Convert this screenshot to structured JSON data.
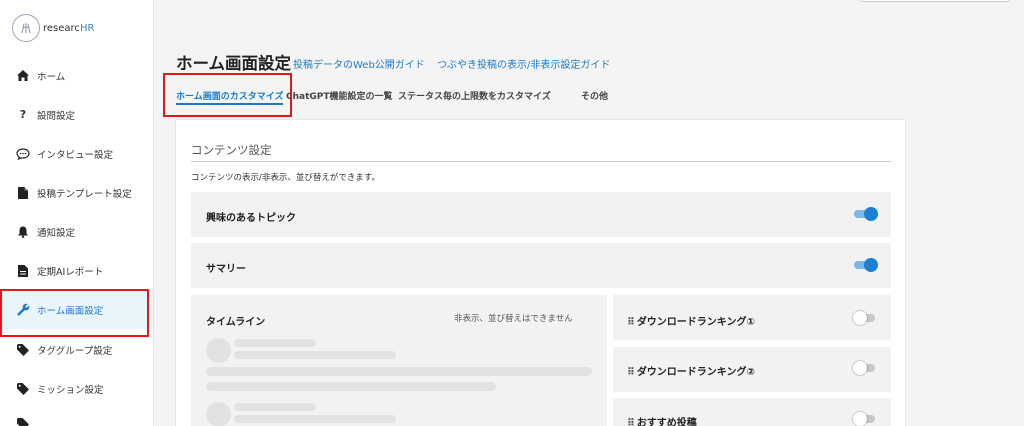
{
  "app": {
    "logo_text": "researc",
    "logo_text_accent": "HR"
  },
  "sidebar": {
    "items": [
      {
        "label": "ホーム",
        "icon": "home-icon"
      },
      {
        "label": "設問設定",
        "icon": "question-icon"
      },
      {
        "label": "インタビュー設定",
        "icon": "chat-bubble-icon"
      },
      {
        "label": "投稿テンプレート設定",
        "icon": "document-icon"
      },
      {
        "label": "通知設定",
        "icon": "bell-icon"
      },
      {
        "label": "定期AIレポート",
        "icon": "report-icon"
      },
      {
        "label": "ホーム画面設定",
        "icon": "wrench-icon"
      },
      {
        "label": "タググループ設定",
        "icon": "tag-icon"
      },
      {
        "label": "ミッション設定",
        "icon": "tag-icon"
      }
    ]
  },
  "header": {
    "title": "ホーム画面設定",
    "guide_links": [
      "投稿データのWeb公開ガイド",
      "つぶやき投稿の表示/非表示設定ガイド"
    ]
  },
  "tabs": [
    {
      "label": "ホーム画面のカスタマイズ",
      "active": true
    },
    {
      "label": "ChatGPT機能設定の一覧",
      "active": false
    },
    {
      "label": "ステータス毎の上限数をカスタマイズ",
      "active": false
    },
    {
      "label": "その他",
      "active": false
    }
  ],
  "content_settings": {
    "section_title": "コンテンツ設定",
    "description": "コンテンツの表示/非表示、並び替えができます。",
    "rows": [
      {
        "label": "興味のあるトピック",
        "enabled": true
      },
      {
        "label": "サマリー",
        "enabled": true
      }
    ],
    "timeline": {
      "label": "タイムライン",
      "note": "非表示、並び替えはできません"
    },
    "side_items": [
      {
        "label": "ダウンロードランキング①",
        "enabled": false
      },
      {
        "label": "ダウンロードランキング②",
        "enabled": false
      },
      {
        "label": "おすすめ投稿",
        "enabled": false
      }
    ]
  },
  "colors": {
    "accent": "#1b79c8",
    "highlight_box": "#e01a1a",
    "active_bg": "#eaf5fb"
  }
}
